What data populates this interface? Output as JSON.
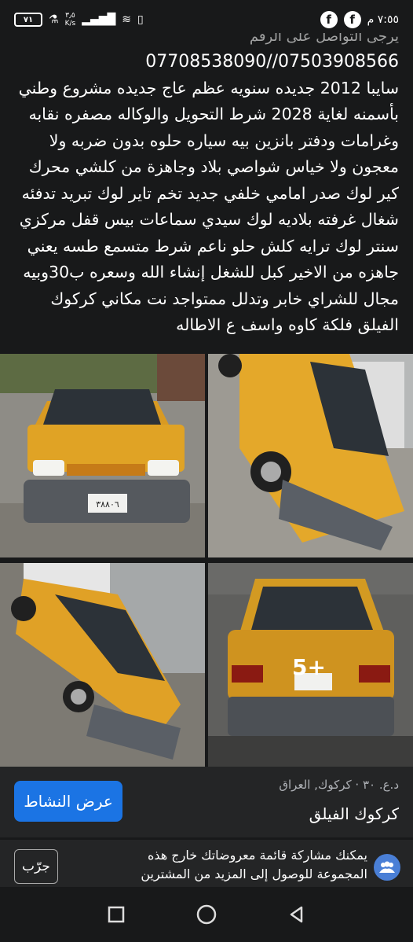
{
  "status_bar": {
    "time": "٧:٥٥ م",
    "battery": "٧١",
    "speed_value": "٣٫٥",
    "speed_unit": "K/s"
  },
  "post": {
    "line_faded": "يرجى التواصل على الرقم",
    "phones": "07708538090//07503908566",
    "body": "سايبا 2012 جديده سنويه عظم عاج جديده مشروع وطني بأسمنه لغاية 2028 شرط التحويل والوكاله مصفره نقابه وغرامات ودفتر بانزين بيه سياره حلوه بدون ضربه ولا معجون ولا خياس شواصي بلاد وجاهزة من كلشي محرك كير لوك صدر امامي خلفي جديد تخم تاير لوك تبريد تدفئه شغال غرفته بلاديه لوك سيدي سماعات بيس قفل مركزي سنتر لوك ترايه كلش حلو ناعم شرط متسمع طسه يعني جاهزه من الاخير كبل للشغل إنشاء الله وسعره ب30وبيه مجال للشراي خابر وتدلل ممتواجد نت مكاني كركوك الفيلق فلكة كاوه واسف ع الاطاله"
  },
  "photos": {
    "more_count": "5+",
    "plate_front": "٣٨٨٠٦"
  },
  "seller": {
    "meta": "د.ع. ٣٠ · كركوك, العراق",
    "location_title": "كركوك الفيلق",
    "activity_button": "عرض النشاط"
  },
  "share_banner": {
    "text": "يمكنك مشاركة قائمة معروضاتك خارج هذه المجموعة للوصول إلى المزيد من المشترين",
    "try_button": "جرّب"
  },
  "colors": {
    "background": "#18191a",
    "panel": "#242526",
    "accent": "#1b74e4",
    "taxi_yellow": "#e8a31c"
  }
}
